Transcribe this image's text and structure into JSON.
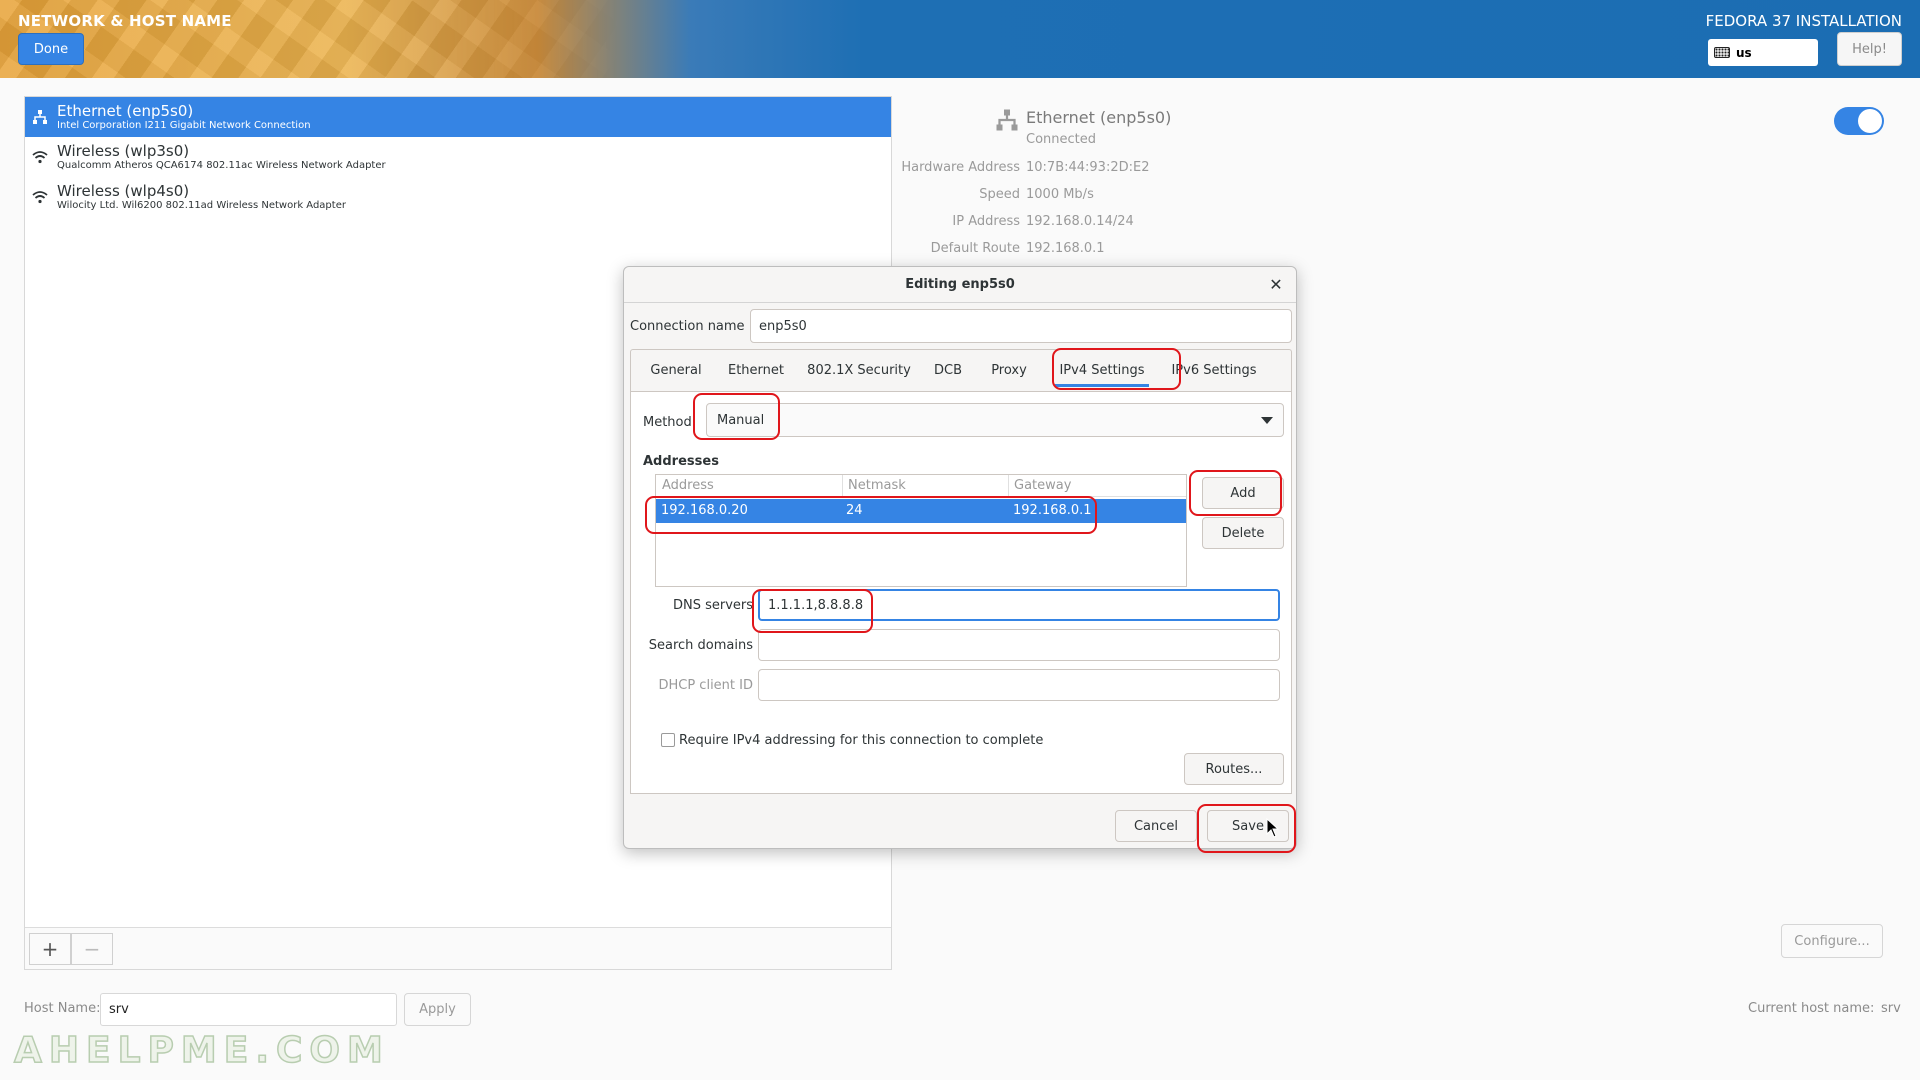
{
  "header": {
    "spoke_title": "NETWORK & HOST NAME",
    "done_label": "Done",
    "product_title": "FEDORA 37 INSTALLATION",
    "keyboard_layout": "us",
    "help_label": "Help!"
  },
  "devices": [
    {
      "name": "Ethernet (enp5s0)",
      "description": "Intel Corporation I211 Gigabit Network Connection",
      "icon": "network-wired-icon",
      "selected": true
    },
    {
      "name": "Wireless (wlp3s0)",
      "description": "Qualcomm Atheros QCA6174 802.11ac Wireless Network Adapter",
      "icon": "wifi-icon",
      "selected": false
    },
    {
      "name": "Wireless (wlp4s0)",
      "description": "Wilocity Ltd. Wil6200 802.11ad Wireless Network Adapter",
      "icon": "wifi-icon",
      "selected": false
    }
  ],
  "list_controls": {
    "add": "+",
    "remove": "−"
  },
  "detail": {
    "device_name": "Ethernet (enp5s0)",
    "status": "Connected",
    "toggle_on": true,
    "rows": [
      {
        "label": "Hardware Address",
        "value": "10:7B:44:93:2D:E2"
      },
      {
        "label": "Speed",
        "value": "1000 Mb/s"
      },
      {
        "label": "IP Address",
        "value": "192.168.0.14/24"
      },
      {
        "label": "Default Route",
        "value": "192.168.0.1"
      }
    ],
    "configure_label": "Configure..."
  },
  "host": {
    "label": "Host Name:",
    "value": "srv",
    "apply_label": "Apply",
    "current_label": "Current host name:",
    "current_value": "srv"
  },
  "watermark": "AHELPME.COM",
  "dialog": {
    "title": "Editing enp5s0",
    "close_glyph": "✕",
    "connection_name_label": "Connection name",
    "connection_name_value": "enp5s0",
    "tabs": [
      {
        "label": "General",
        "active": false
      },
      {
        "label": "Ethernet",
        "active": false
      },
      {
        "label": "802.1X Security",
        "active": false
      },
      {
        "label": "DCB",
        "active": false
      },
      {
        "label": "Proxy",
        "active": false
      },
      {
        "label": "IPv4 Settings",
        "active": true
      },
      {
        "label": "IPv6 Settings",
        "active": false
      }
    ],
    "method_label": "Method",
    "method_value": "Manual",
    "addresses_heading": "Addresses",
    "address_columns": [
      "Address",
      "Netmask",
      "Gateway"
    ],
    "address_rows": [
      {
        "address": "192.168.0.20",
        "netmask": "24",
        "gateway": "192.168.0.1"
      }
    ],
    "add_label": "Add",
    "delete_label": "Delete",
    "dns_label": "DNS servers",
    "dns_value": "1.1.1.1,8.8.8.8",
    "search_domains_label": "Search domains",
    "search_domains_value": "",
    "dhcp_client_id_label": "DHCP client ID",
    "dhcp_client_id_value": "",
    "require_ipv4_label": "Require IPv4 addressing for this connection to complete",
    "require_ipv4_checked": false,
    "routes_label": "Routes...",
    "cancel_label": "Cancel",
    "save_label": "Save"
  },
  "colors": {
    "accent": "#3584e4",
    "highlight": "#e0161b",
    "header_blue": "#1b6db3",
    "header_orange": "#e8a43a"
  }
}
